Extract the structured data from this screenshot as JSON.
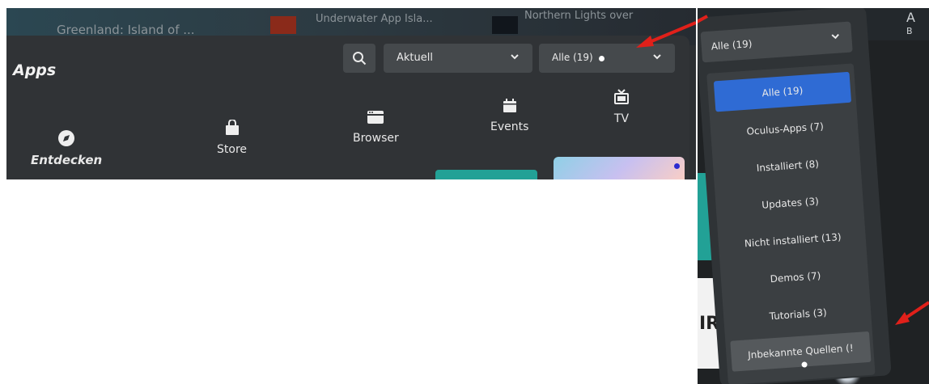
{
  "background": {
    "media_titles": [
      "Greenland: Island of ...",
      "Underwater App Isla...",
      "Northern Lights over"
    ],
    "right_partial_text": [
      "A",
      "B"
    ]
  },
  "header": {
    "title": "Apps",
    "sort_dropdown": {
      "label": "Aktuell"
    },
    "filter_dropdown": {
      "label": "Alle (19)"
    }
  },
  "nav": [
    {
      "label": "Entdecken",
      "icon": "compass-icon"
    },
    {
      "label": "Store",
      "icon": "shopping-bag-icon"
    },
    {
      "label": "Browser",
      "icon": "browser-icon"
    },
    {
      "label": "Events",
      "icon": "calendar-icon"
    },
    {
      "label": "TV",
      "icon": "tv-icon"
    }
  ],
  "filter_menu": {
    "header_label": "Alle (19)",
    "items": [
      {
        "label": "Alle (19)",
        "selected": true
      },
      {
        "label": "Oculus-Apps (7)"
      },
      {
        "label": "Installiert (8)"
      },
      {
        "label": "Updates (3)"
      },
      {
        "label": "Nicht installiert (13)"
      },
      {
        "label": "Demos (7)"
      },
      {
        "label": "Tutorials (3)"
      },
      {
        "label": "Jnbekannte Quellen (!",
        "hovered": true
      }
    ]
  },
  "partial_card_text": "IR",
  "colors": {
    "panel": "#303336",
    "control": "#45494c",
    "selected": "#2f6bd4",
    "teal": "#22a196",
    "annotation_arrow": "#e0201a"
  }
}
